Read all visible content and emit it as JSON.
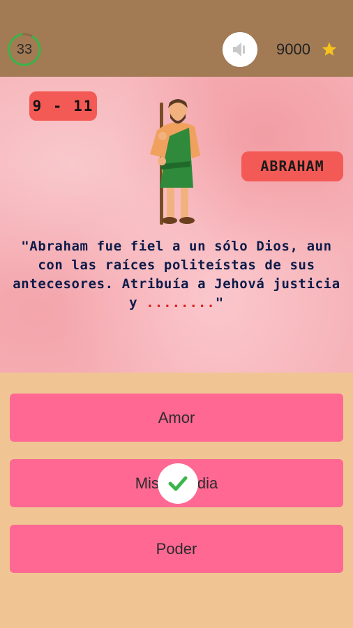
{
  "header": {
    "timer_value": "33",
    "timer_color": "#3bb54a",
    "sound_icon": "speaker-icon",
    "score": "9000",
    "score_icon": "star-icon",
    "star_color": "#f6c21c"
  },
  "question": {
    "range": "9 - 11",
    "character_name": "ABRAHAM",
    "text": "\"Abraham fue fiel a un sólo Dios, aun con las raíces politeístas de sus antecesores. Atribuía a Jehová justicia y ",
    "blank": "........",
    "closing": "\""
  },
  "answers": [
    {
      "label": "Amor"
    },
    {
      "label": "Misericordia",
      "status": "correct",
      "status_icon": "check-icon"
    },
    {
      "label": "Poder"
    }
  ],
  "colors": {
    "header_bg": "#a27b55",
    "panel_bg": "#f6b3b8",
    "badge_bg": "#f45a55",
    "answer_bg": "#fe6893",
    "footer_bg": "#f0c593"
  }
}
